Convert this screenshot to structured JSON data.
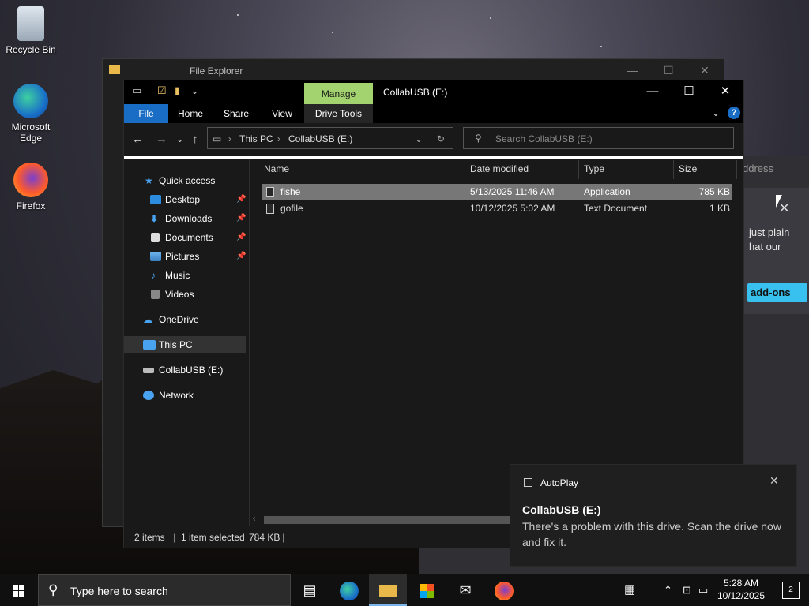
{
  "desktop": {
    "icons": [
      {
        "label": "Recycle Bin",
        "icon": "recycle-bin-icon"
      },
      {
        "label": "Microsoft Edge",
        "icon": "edge-icon"
      },
      {
        "label": "Firefox",
        "icon": "firefox-icon"
      }
    ]
  },
  "background_browser": {
    "address_fragment": "ddress",
    "notice_text": "just plain\nhat our",
    "addons_button": "add-ons"
  },
  "back_window": {
    "title": "File Explorer"
  },
  "explorer": {
    "title": "CollabUSB (E:)",
    "contextual_tab_group": "Manage",
    "ribbon_tabs": [
      "File",
      "Home",
      "Share",
      "View",
      "Drive Tools"
    ],
    "address": {
      "segments": [
        "This PC",
        "CollabUSB (E:)"
      ]
    },
    "search_placeholder": "Search CollabUSB (E:)",
    "nav": [
      {
        "label": "Quick access",
        "icon": "star-icon",
        "pinned": false
      },
      {
        "label": "Desktop",
        "icon": "desktop-icon",
        "pinned": true
      },
      {
        "label": "Downloads",
        "icon": "download-icon",
        "pinned": true
      },
      {
        "label": "Documents",
        "icon": "documents-icon",
        "pinned": true
      },
      {
        "label": "Pictures",
        "icon": "pictures-icon",
        "pinned": true
      },
      {
        "label": "Music",
        "icon": "music-icon",
        "pinned": false
      },
      {
        "label": "Videos",
        "icon": "videos-icon",
        "pinned": false
      },
      {
        "label": "OneDrive",
        "icon": "cloud-icon",
        "pinned": false
      },
      {
        "label": "This PC",
        "icon": "computer-icon",
        "pinned": false
      },
      {
        "label": "CollabUSB (E:)",
        "icon": "drive-icon",
        "pinned": false
      },
      {
        "label": "Network",
        "icon": "network-icon",
        "pinned": false
      }
    ],
    "columns": [
      "Name",
      "Date modified",
      "Type",
      "Size"
    ],
    "files": [
      {
        "name": "fishe",
        "date": "5/13/2025 11:46 AM",
        "type": "Application",
        "size": "785 KB",
        "selected": true
      },
      {
        "name": "gofile",
        "date": "10/12/2025 5:02 AM",
        "type": "Text Document",
        "size": "1 KB",
        "selected": false
      }
    ],
    "status": {
      "items": "2 items",
      "selected": "1 item selected",
      "size": "784 KB"
    }
  },
  "toast": {
    "app": "AutoPlay",
    "heading": "CollabUSB (E:)",
    "body": "There's a problem with this drive.  Scan the drive now and fix it."
  },
  "taskbar": {
    "search_placeholder": "Type here to search",
    "pinned": [
      "task-view-icon",
      "edge-icon",
      "file-explorer-icon",
      "store-icon",
      "mail-icon",
      "firefox-icon"
    ],
    "time": "5:28 AM",
    "date": "10/12/2025",
    "notification_count": "2"
  },
  "colors": {
    "accent": "#1a6dc4",
    "manage_tab": "#a3d36e",
    "selection": "#777777"
  }
}
